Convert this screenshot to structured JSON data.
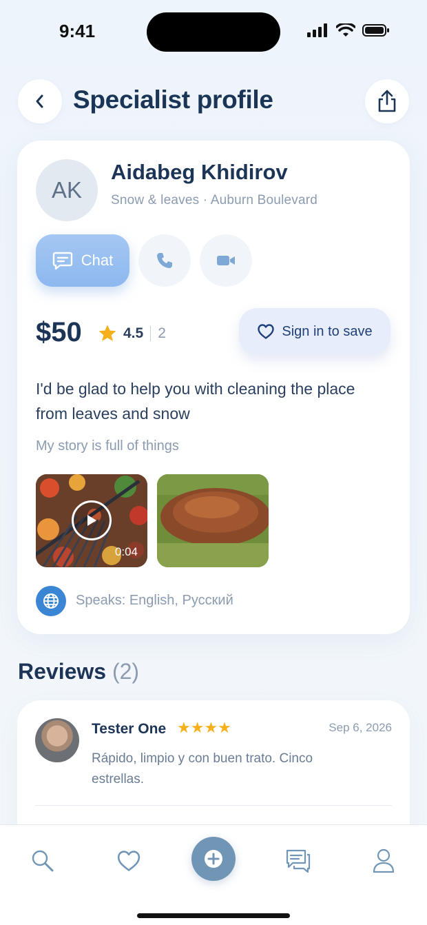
{
  "status_bar": {
    "time": "9:41"
  },
  "header": {
    "title": "Specialist profile"
  },
  "profile": {
    "initials": "AK",
    "name": "Aidabeg Khidirov",
    "subtitle": "Snow & leaves · Auburn Boulevard",
    "chat_label": "Chat",
    "price": "$50",
    "rating": "4.5",
    "rating_count": "2",
    "save_label": "Sign in to save",
    "bio": "I'd be glad to help you with cleaning the place from leaves and snow",
    "story": "My story is full of things",
    "video_duration": "0:04",
    "languages": "Speaks: English, Русский"
  },
  "reviews": {
    "title": "Reviews",
    "count": "(2)",
    "items": [
      {
        "author": "Tester One",
        "stars": "★★★★",
        "date": "Sep 6, 2026",
        "text": "Rápido, limpio y con buen trato. Cinco estrellas."
      }
    ]
  },
  "colors": {
    "accent": "#8db8ee",
    "title": "#1c3456",
    "muted": "#8b9bb0",
    "star": "#f5b01b",
    "nav_add": "#7196b5"
  },
  "icons": {
    "back": "chevron-left-icon",
    "share": "share-icon",
    "chat": "chat-bubble-icon",
    "phone": "phone-icon",
    "video": "video-camera-icon",
    "heart": "heart-icon",
    "globe": "globe-icon",
    "nav": [
      "search-icon",
      "heart-icon",
      "plus-icon",
      "messages-icon",
      "profile-icon"
    ]
  }
}
